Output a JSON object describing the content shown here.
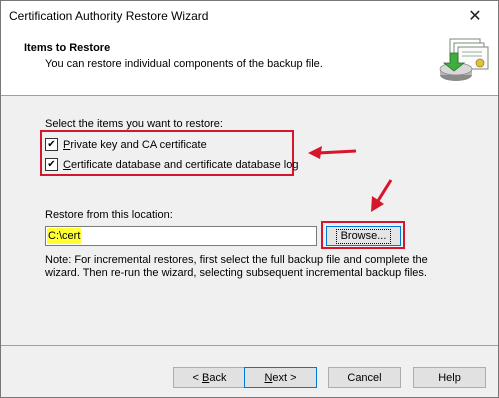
{
  "window": {
    "title": "Certification Authority Restore Wizard",
    "close_glyph": "✕"
  },
  "header": {
    "title": "Items to Restore",
    "subtitle": "You can restore individual components of the backup file.",
    "graphic_icon": "certificate-stack-icon"
  },
  "main": {
    "select_label": "Select the items you want to restore:",
    "items": [
      {
        "label": "Private key and CA certificate",
        "checked": true
      },
      {
        "label": "Certificate database and certificate database log",
        "checked": true
      }
    ],
    "restore_label": "Restore from this location:",
    "location_value": "C:\\cert",
    "browse_label": "Browse...",
    "note": "Note: For incremental restores, first select the full backup file and complete the wizard. Then re-run the wizard, selecting subsequent incremental backup files."
  },
  "buttons": {
    "back": "< Back",
    "next": "Next >",
    "cancel": "Cancel",
    "help": "Help"
  },
  "colors": {
    "annotation_red": "#d6162a",
    "highlight_yellow": "#ffff33",
    "focus_blue": "#0078d7"
  }
}
